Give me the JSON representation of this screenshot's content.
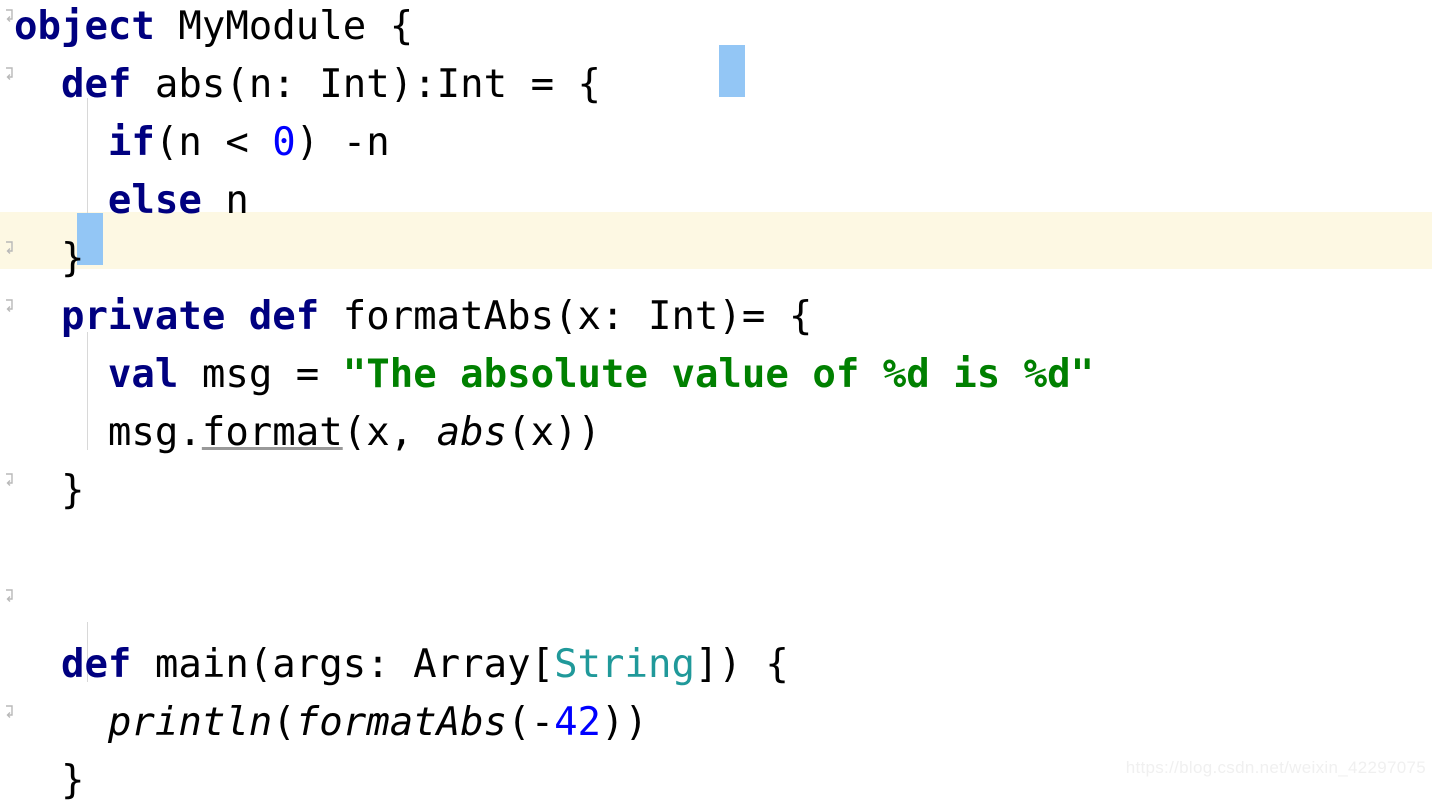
{
  "editor": {
    "language": "Scala",
    "theme": {
      "background": "#ffffff",
      "current_line_background": "#fdf8e3",
      "brace_match_background": "#93c6f5",
      "keyword_color": "#000080",
      "string_color": "#008000",
      "number_color": "#0000ff",
      "type_color": "#20999a",
      "default_text_color": "#000000",
      "indent_guide_color": "#d8d8d8",
      "gutter_fold_icon_color": "#b8b8b8"
    },
    "current_line_number": 5,
    "lines": [
      {
        "n": 1,
        "indent": "",
        "text": "object MyModule {",
        "tokens": [
          {
            "t": "object",
            "c": "kw"
          },
          {
            "t": " MyModule {",
            "c": "plain"
          }
        ],
        "fold_arrow": true
      },
      {
        "n": 2,
        "indent": "  ",
        "text": "  def abs(n: Int):Int = {",
        "tokens": [
          {
            "t": "  ",
            "c": "ind"
          },
          {
            "t": "def",
            "c": "kw"
          },
          {
            "t": " abs(n: Int):Int = ",
            "c": "plain"
          },
          {
            "t": "{",
            "c": "plain"
          }
        ],
        "fold_arrow": true
      },
      {
        "n": 3,
        "indent": "    ",
        "text": "    if(n < 0) -n",
        "tokens": [
          {
            "t": "    ",
            "c": "ind"
          },
          {
            "t": "if",
            "c": "kw"
          },
          {
            "t": "(n < ",
            "c": "plain"
          },
          {
            "t": "0",
            "c": "num"
          },
          {
            "t": ") -n",
            "c": "plain"
          }
        ],
        "fold_arrow": false
      },
      {
        "n": 4,
        "indent": "    ",
        "text": "    else n",
        "tokens": [
          {
            "t": "    ",
            "c": "ind"
          },
          {
            "t": "else",
            "c": "kw"
          },
          {
            "t": " n",
            "c": "plain"
          }
        ],
        "fold_arrow": false
      },
      {
        "n": 5,
        "indent": "  ",
        "text": "  }",
        "tokens": [
          {
            "t": "  ",
            "c": "ind"
          },
          {
            "t": "}",
            "c": "plain"
          }
        ],
        "fold_arrow": true,
        "highlighted": true
      },
      {
        "n": 6,
        "indent": "  ",
        "text": "  private def formatAbs(x: Int)= {",
        "tokens": [
          {
            "t": "  ",
            "c": "ind"
          },
          {
            "t": "private def",
            "c": "kw"
          },
          {
            "t": " formatAbs(x: Int)= {",
            "c": "plain"
          }
        ],
        "fold_arrow": true
      },
      {
        "n": 7,
        "indent": "    ",
        "text": "    val msg = \"The absolute value of %d is %d\"",
        "tokens": [
          {
            "t": "    ",
            "c": "ind"
          },
          {
            "t": "val",
            "c": "kw"
          },
          {
            "t": " msg = ",
            "c": "plain"
          },
          {
            "t": "\"The absolute value of %d is %d\"",
            "c": "str"
          }
        ],
        "fold_arrow": false
      },
      {
        "n": 8,
        "indent": "    ",
        "text": "    msg.format(x, abs(x))",
        "tokens": [
          {
            "t": "    ",
            "c": "ind"
          },
          {
            "t": "msg.",
            "c": "plain"
          },
          {
            "t": "format",
            "c": "mth-und"
          },
          {
            "t": "(x, ",
            "c": "plain"
          },
          {
            "t": "abs",
            "c": "mth-it"
          },
          {
            "t": "(x))",
            "c": "plain"
          }
        ],
        "fold_arrow": false
      },
      {
        "n": 9,
        "indent": "  ",
        "text": "  }",
        "tokens": [
          {
            "t": "  ",
            "c": "ind"
          },
          {
            "t": "}",
            "c": "plain"
          }
        ],
        "fold_arrow": true
      },
      {
        "n": 10,
        "indent": "",
        "text": "",
        "tokens": [],
        "fold_arrow": false
      },
      {
        "n": 11,
        "indent": "",
        "text": "",
        "tokens": [],
        "fold_arrow": false
      },
      {
        "n": 12,
        "indent": "  ",
        "text": "  def main(args: Array[String]) {",
        "tokens": [
          {
            "t": "  ",
            "c": "ind"
          },
          {
            "t": "def",
            "c": "kw"
          },
          {
            "t": " main(args: Array[",
            "c": "plain"
          },
          {
            "t": "String",
            "c": "type-hl"
          },
          {
            "t": "]) {",
            "c": "plain"
          }
        ],
        "fold_arrow": true
      },
      {
        "n": 13,
        "indent": "    ",
        "text": "    println(formatAbs(-42))",
        "tokens": [
          {
            "t": "    ",
            "c": "ind"
          },
          {
            "t": "println",
            "c": "mth-it"
          },
          {
            "t": "(",
            "c": "plain"
          },
          {
            "t": "formatAbs",
            "c": "mth-it"
          },
          {
            "t": "(-",
            "c": "plain"
          },
          {
            "t": "42",
            "c": "num"
          },
          {
            "t": "))",
            "c": "plain"
          }
        ],
        "fold_arrow": false
      },
      {
        "n": 14,
        "indent": "  ",
        "text": "  }",
        "tokens": [
          {
            "t": "  ",
            "c": "ind"
          },
          {
            "t": "}",
            "c": "plain"
          }
        ],
        "fold_arrow": true
      }
    ]
  },
  "watermark": {
    "text": "https://blog.csdn.net/weixin_42297075"
  }
}
